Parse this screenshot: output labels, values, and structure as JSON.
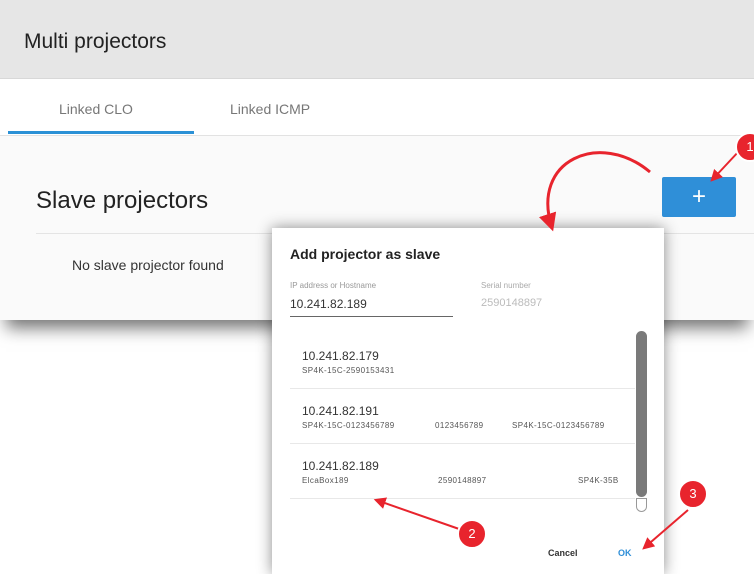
{
  "header": {
    "title": "Multi projectors"
  },
  "tabs": [
    {
      "label": "Linked CLO",
      "active": true
    },
    {
      "label": "Linked ICMP",
      "active": false
    }
  ],
  "section": {
    "title": "Slave projectors",
    "empty_message": "No slave projector found",
    "add_button_label": "+"
  },
  "dialog": {
    "title": "Add projector as slave",
    "ip_field": {
      "label": "IP address or Hostname",
      "value": "10.241.82.189"
    },
    "serial_field": {
      "label": "Serial number",
      "value": "2590148897"
    },
    "list": [
      {
        "ip": "10.241.82.179",
        "col1": "SP4K-15C-2590153431",
        "col2": "",
        "col3": ""
      },
      {
        "ip": "10.241.82.191",
        "col1": "SP4K-15C-0123456789",
        "col2": "0123456789",
        "col3": "SP4K-15C-0123456789"
      },
      {
        "ip": "10.241.82.189",
        "col1": "ElcaBox189",
        "col2": "2590148897",
        "col3": "SP4K-35B"
      }
    ],
    "cancel_label": "Cancel",
    "ok_label": "OK"
  },
  "callouts": [
    "1",
    "2",
    "3"
  ],
  "colors": {
    "accent": "#2f8fd8",
    "callout": "#e8242d"
  }
}
